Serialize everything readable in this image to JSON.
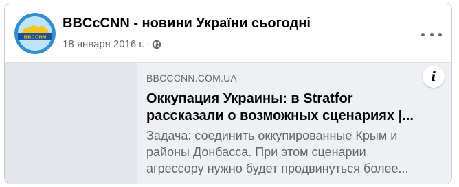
{
  "post": {
    "page_name": "BBCcCNN - новини України сьогодні",
    "avatar_logo_text": "BBCCNN",
    "date": "18 января 2016 г.",
    "separator": "·",
    "audience_icon": "globe-icon",
    "more_icon": "more-horizontal-icon"
  },
  "link_preview": {
    "domain": "BBCCCNN.COM.UA",
    "headline": "Оккупация Украины: в Stratfor\nрассказали о возможных сценариях |...",
    "description": "Задача: соединить оккупированные Крым и\nрайоны Донбасса. При этом сценарии\nагрессору нужно будет продвинуться более...",
    "info_icon": "info-icon",
    "info_label": "i"
  },
  "colors": {
    "avatar_ring": "#2f8fd0",
    "avatar_map": "#f5c518",
    "avatar_banner": "#1f4f99"
  }
}
